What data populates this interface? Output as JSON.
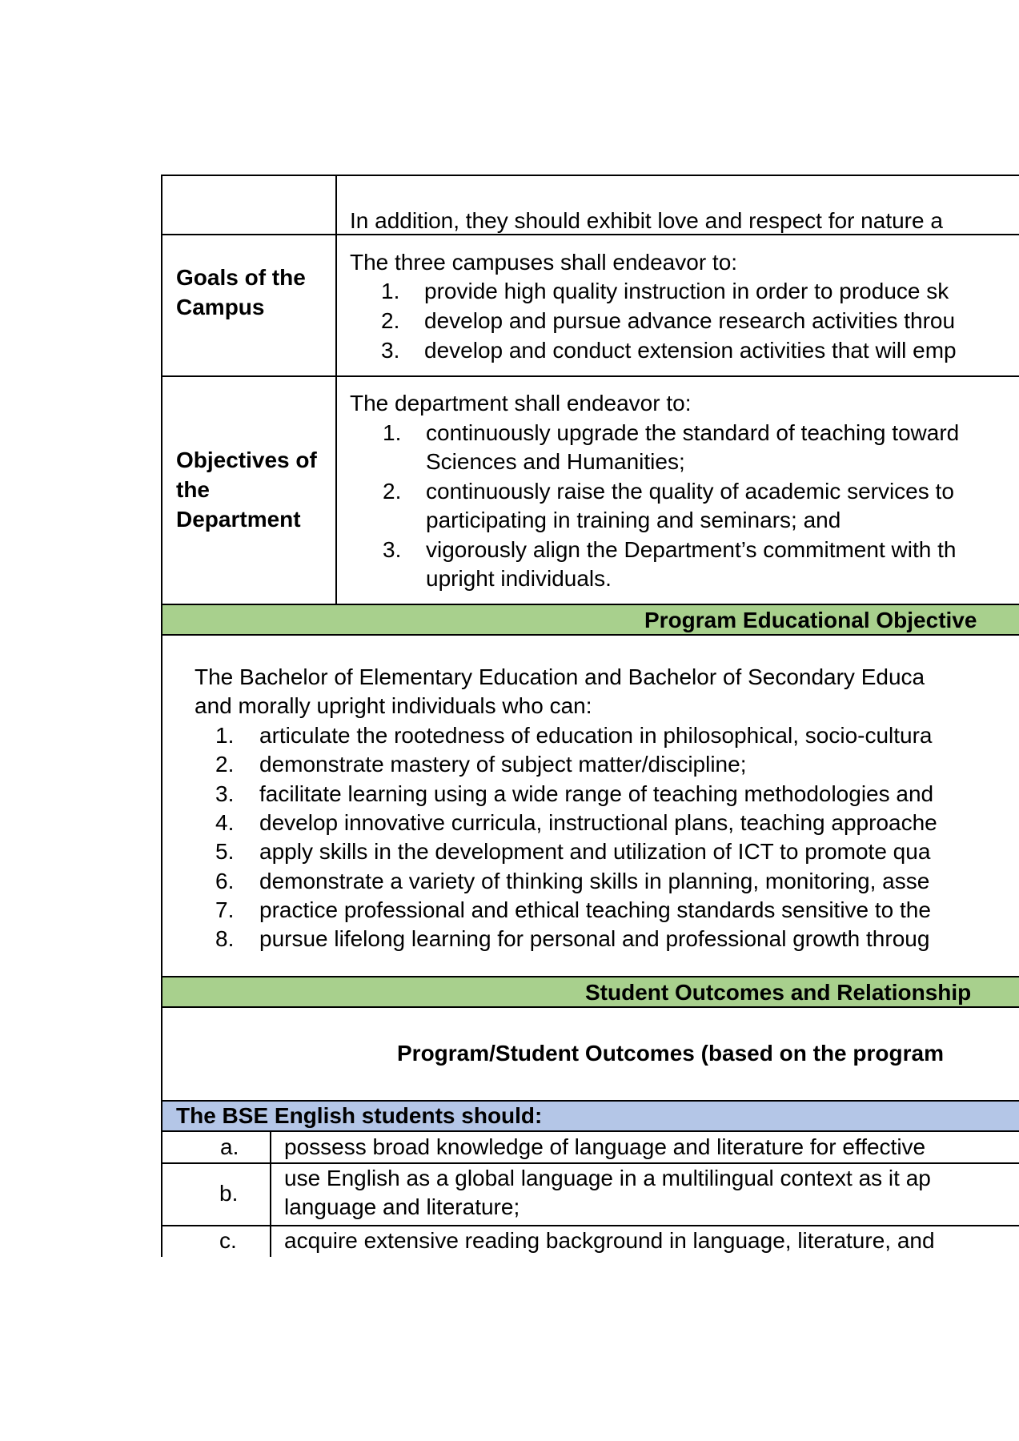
{
  "table": {
    "row1": {
      "text": "In addition, they should exhibit love and respect for nature a"
    },
    "goals": {
      "label": "Goals of the Campus",
      "intro": "The three campuses shall endeavor to:",
      "items": [
        {
          "num": "1.",
          "text": "provide high quality instruction in order to produce sk"
        },
        {
          "num": "2.",
          "text": "develop and pursue advance research activities throu"
        },
        {
          "num": "3.",
          "text": "develop and conduct extension activities that will emp"
        }
      ]
    },
    "objectives": {
      "label": "Objectives of the Department",
      "intro": "The department shall endeavor to:",
      "items": [
        {
          "num": "1.",
          "line1": "continuously upgrade the standard of teaching toward",
          "line2": "Sciences and Humanities;"
        },
        {
          "num": "2.",
          "line1": "continuously raise the quality of academic services to",
          "line2": "participating in training and seminars; and"
        },
        {
          "num": "3.",
          "line1": "vigorously align the Department’s commitment with th",
          "line2": "upright individuals."
        }
      ]
    },
    "peo": {
      "header": "Program Educational Objective",
      "intro1": "The Bachelor of Elementary Education and Bachelor of Secondary Educa",
      "intro2": "and morally upright individuals who can:",
      "items": [
        {
          "num": "1.",
          "text": "articulate the rootedness of education in philosophical, socio-cultura"
        },
        {
          "num": "2.",
          "text": "demonstrate mastery of subject matter/discipline;"
        },
        {
          "num": "3.",
          "text": "facilitate learning using a wide range of teaching methodologies and"
        },
        {
          "num": "4.",
          "text": "develop innovative curricula, instructional plans, teaching approache"
        },
        {
          "num": "5.",
          "text": "apply skills in the development and utilization of ICT to promote qua"
        },
        {
          "num": "6.",
          "text": "demonstrate a variety of thinking skills in planning, monitoring, asse"
        },
        {
          "num": "7.",
          "text": "practice professional and ethical teaching standards sensitive to the"
        },
        {
          "num": "8.",
          "text": "pursue lifelong learning for personal and professional growth throug"
        }
      ]
    },
    "so": {
      "header": "Student Outcomes and Relationship",
      "subheader": "Program/Student Outcomes (based on the program",
      "students_header": "The BSE English students should:",
      "rows": [
        {
          "letter": "a.",
          "line1": "possess broad knowledge of language and literature for effective",
          "line2": ""
        },
        {
          "letter": "b.",
          "line1": "use English as a global language in a multilingual context as it ap",
          "line2": "language and literature;"
        },
        {
          "letter": "c.",
          "line1": "acquire extensive reading background in language, literature, and",
          "line2": ""
        }
      ]
    }
  }
}
